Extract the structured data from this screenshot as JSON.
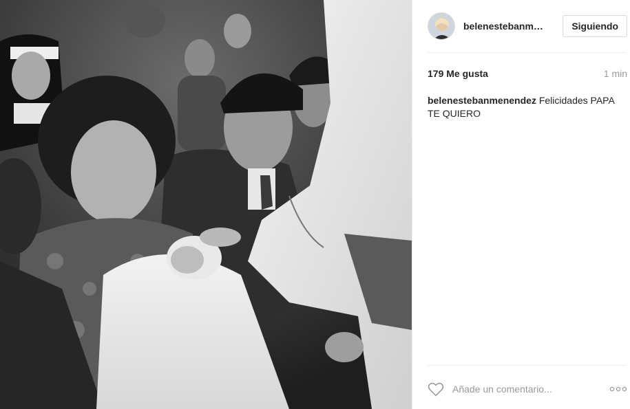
{
  "post": {
    "photo": {
      "description_icon": "vintage-baptism-photo"
    },
    "header": {
      "username": "belenestebanm…",
      "follow_label": "Siguiendo",
      "avatar_icon": "profile-avatar"
    },
    "likes": "179 Me gusta",
    "time": "1 min",
    "caption": {
      "user": "belenestebanmenendez",
      "text": " Felicidades PAPA TE QUIERO"
    },
    "comment": {
      "placeholder": "Añade un comentario...",
      "heart_icon": "heart-outline-icon",
      "more_icon": "ellipsis-icon"
    }
  },
  "colors": {
    "border": "#efefef",
    "button_border": "#dbdbdb",
    "text": "#262626",
    "muted": "#999999"
  }
}
